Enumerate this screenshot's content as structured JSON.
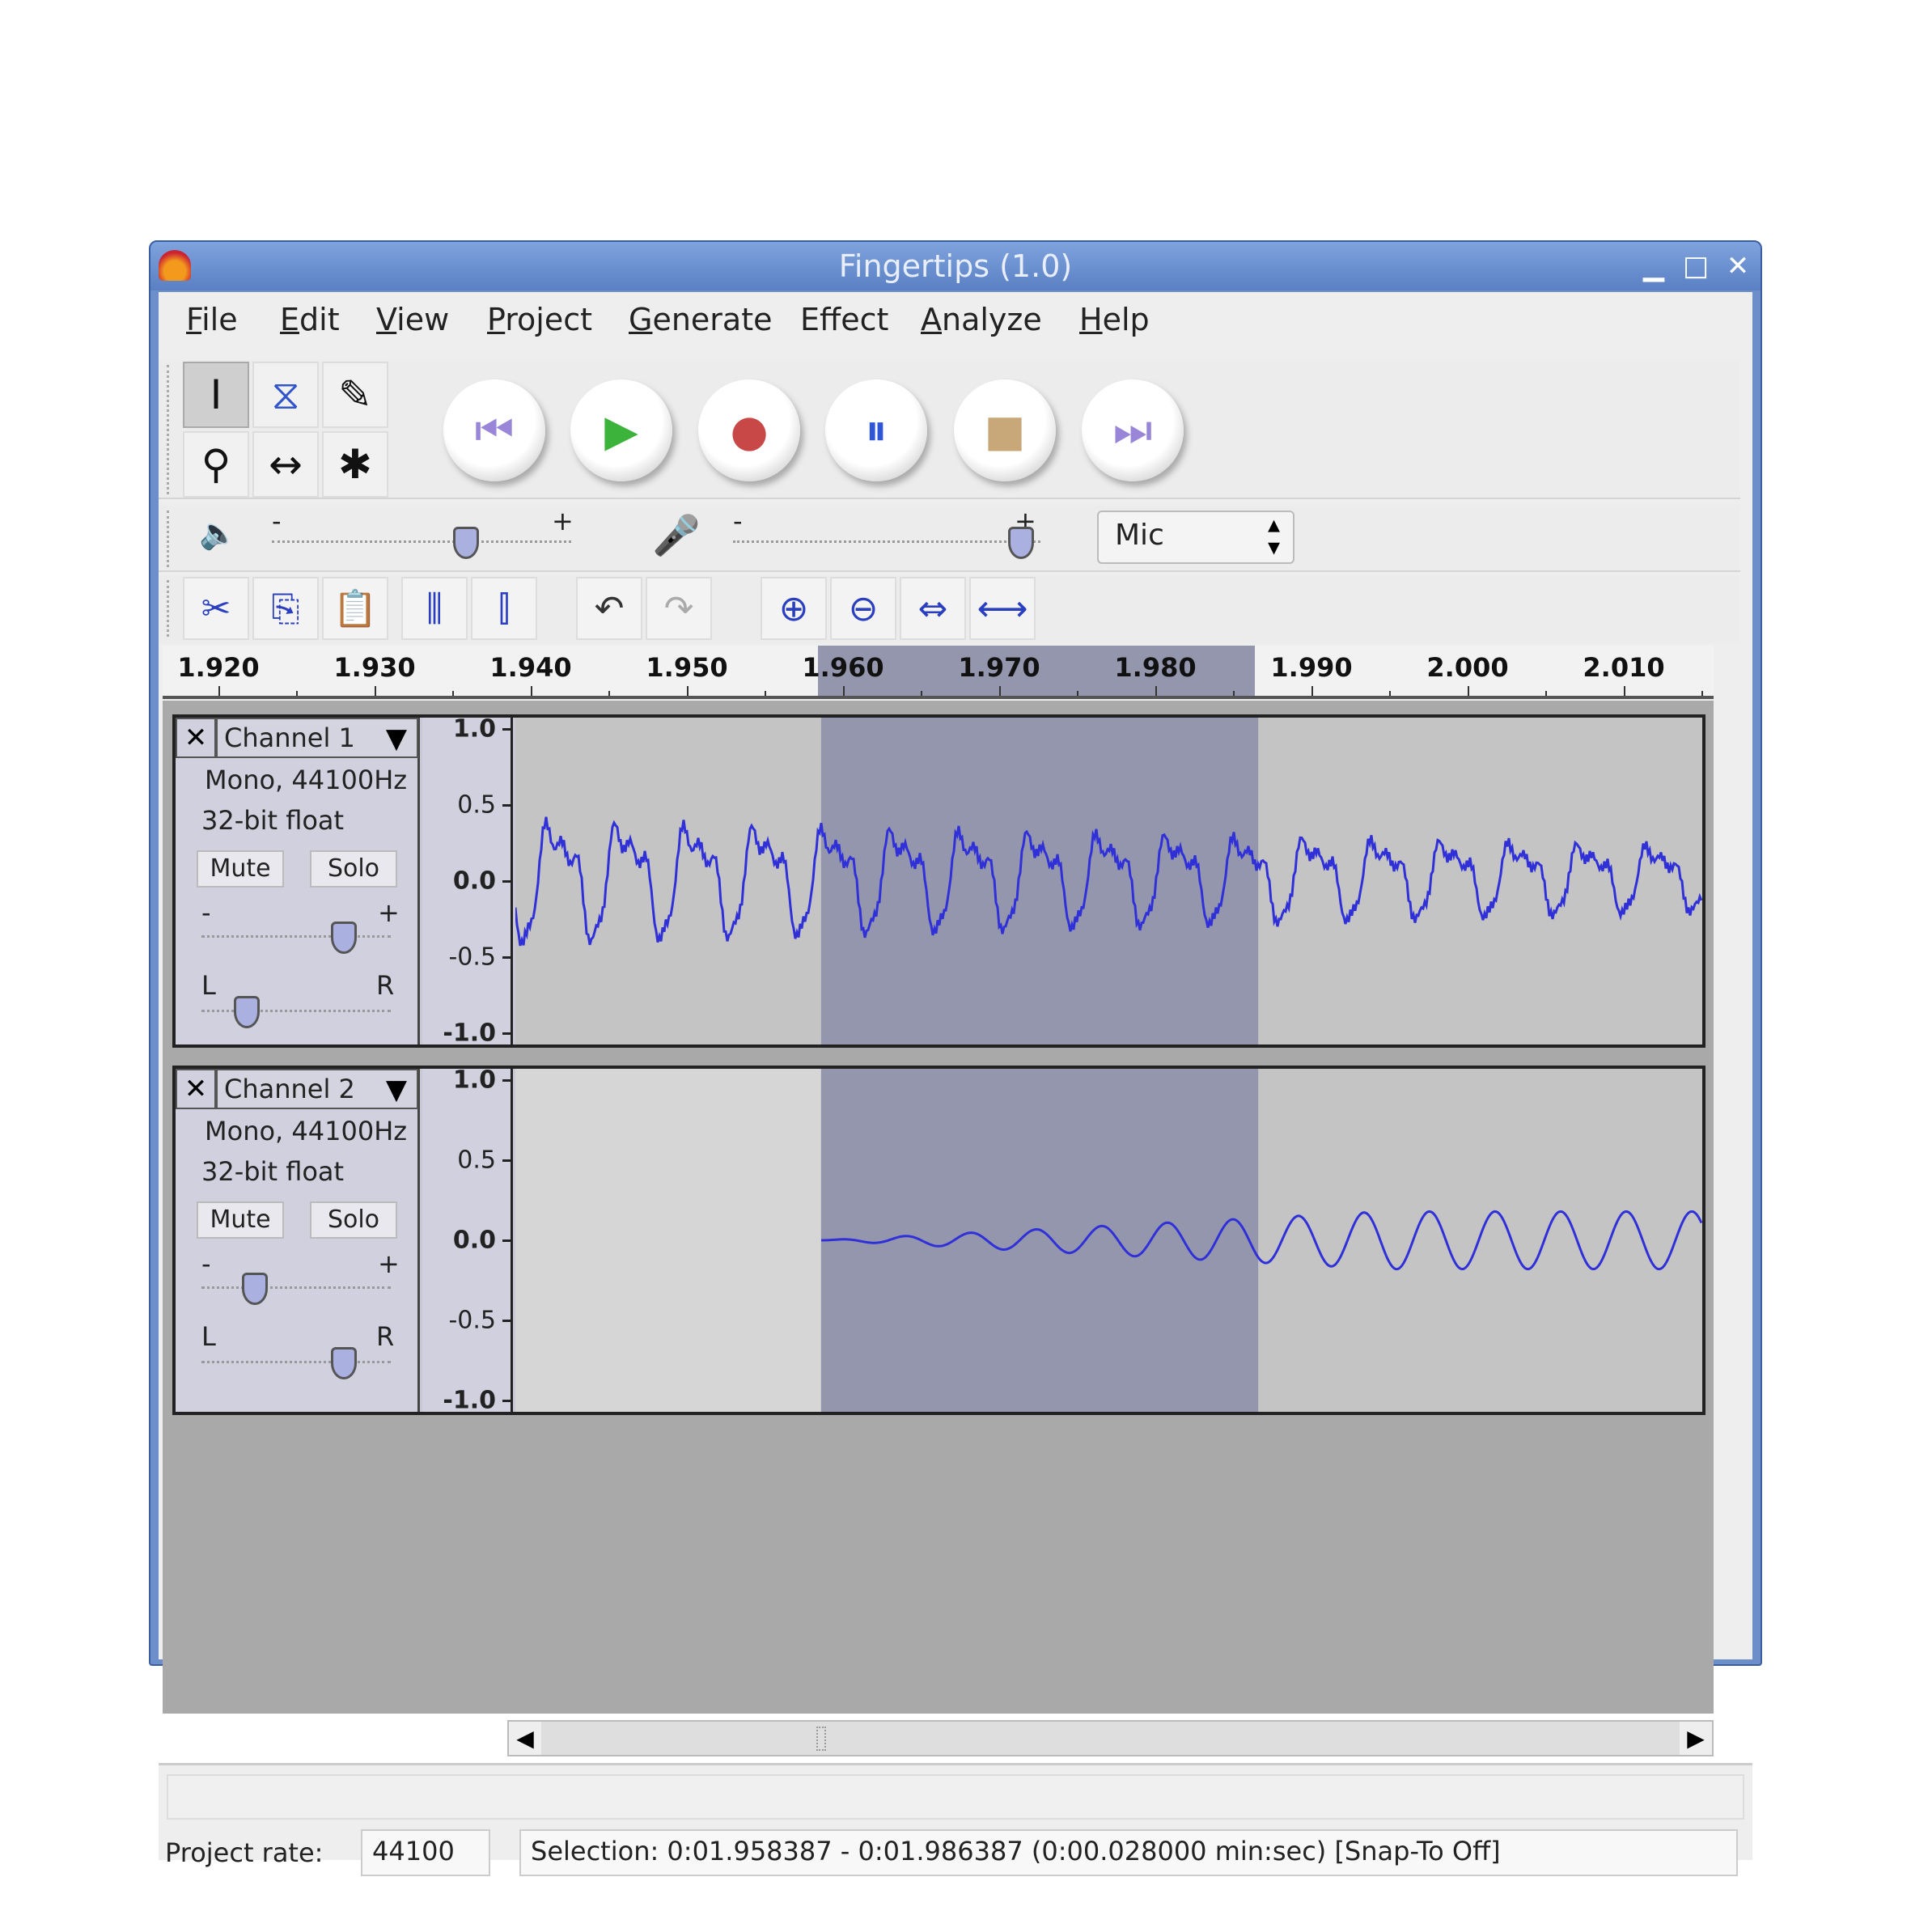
{
  "window": {
    "title": "Fingertips (1.0)",
    "minimize": "▁",
    "maximize": "□",
    "close": "✕"
  },
  "menu": [
    {
      "label": "File",
      "u": "F",
      "rest": "ile"
    },
    {
      "label": "Edit",
      "u": "E",
      "rest": "dit"
    },
    {
      "label": "View",
      "u": "V",
      "rest": "iew"
    },
    {
      "label": "Project",
      "u": "P",
      "rest": "roject"
    },
    {
      "label": "Generate",
      "u": "G",
      "rest": "enerate"
    },
    {
      "label": "Effect",
      "u": "",
      "rest": "Effect"
    },
    {
      "label": "Analyze",
      "u": "A",
      "rest": "nalyze"
    },
    {
      "label": "Help",
      "u": "H",
      "rest": "elp"
    }
  ],
  "tools": {
    "selection": "I",
    "envelope": "⧖",
    "draw": "✎",
    "zoom": "⚲",
    "timeshift": "↔",
    "multi": "✱"
  },
  "transport": {
    "skip_start": "⏮",
    "play": "▶",
    "record": "●",
    "pause": "⏸",
    "stop": "■",
    "skip_end": "⏭",
    "colors": {
      "skip": "#9a86d8",
      "play": "#3cb43c",
      "record": "#c84848",
      "pause": "#2f55d8",
      "stop": "#c8a878"
    }
  },
  "mixer": {
    "speaker": "🔈",
    "mic": "🎤",
    "minus": "-",
    "plus": "+",
    "output_volume": 0.66,
    "input_volume": 0.97,
    "input_source": "Mic"
  },
  "edit_tools": {
    "cut": "✂",
    "copy": "⎘",
    "paste": "📋",
    "trim": "⫼",
    "silence": "⫿",
    "undo": "↶",
    "redo": "↷",
    "zoom_in": "⊕",
    "zoom_out": "⊖",
    "fit_selection": "⇔",
    "fit_project": "⟷"
  },
  "ruler": {
    "ticks": [
      "1.920",
      "1.930",
      "1.940",
      "1.950",
      "1.960",
      "1.970",
      "1.980",
      "1.990",
      "2.000",
      "2.010"
    ],
    "selection_start": 1.958387,
    "selection_end": 1.986387
  },
  "tracks": [
    {
      "name": "Channel 1",
      "info1": "Mono, 44100Hz",
      "info2": "32-bit float",
      "mute": "Mute",
      "solo": "Solo",
      "gain": 0.8,
      "pan": -0.6,
      "minus": "-",
      "plus": "+",
      "left": "L",
      "right": "R",
      "scale": [
        "1.0",
        "0.5",
        "0.0",
        "-0.5",
        "-1.0"
      ]
    },
    {
      "name": "Channel 2",
      "info1": "Mono, 44100Hz",
      "info2": "32-bit float",
      "mute": "Mute",
      "solo": "Solo",
      "gain": 0.25,
      "pan": 0.6,
      "minus": "-",
      "plus": "+",
      "left": "L",
      "right": "R",
      "scale": [
        "1.0",
        "0.5",
        "0.0",
        "-0.5",
        "-1.0"
      ]
    }
  ],
  "colors": {
    "waveform": "#3030d8",
    "selection": "#9496ad",
    "track_bg": "#c4c4c4",
    "track_bg_light": "#d6d6d6"
  },
  "status": {
    "project_rate_label": "Project rate:",
    "project_rate": "44100",
    "selection": "Selection: 0:01.958387 - 0:01.986387 (0:00.028000 min:sec)   [Snap-To Off]"
  }
}
